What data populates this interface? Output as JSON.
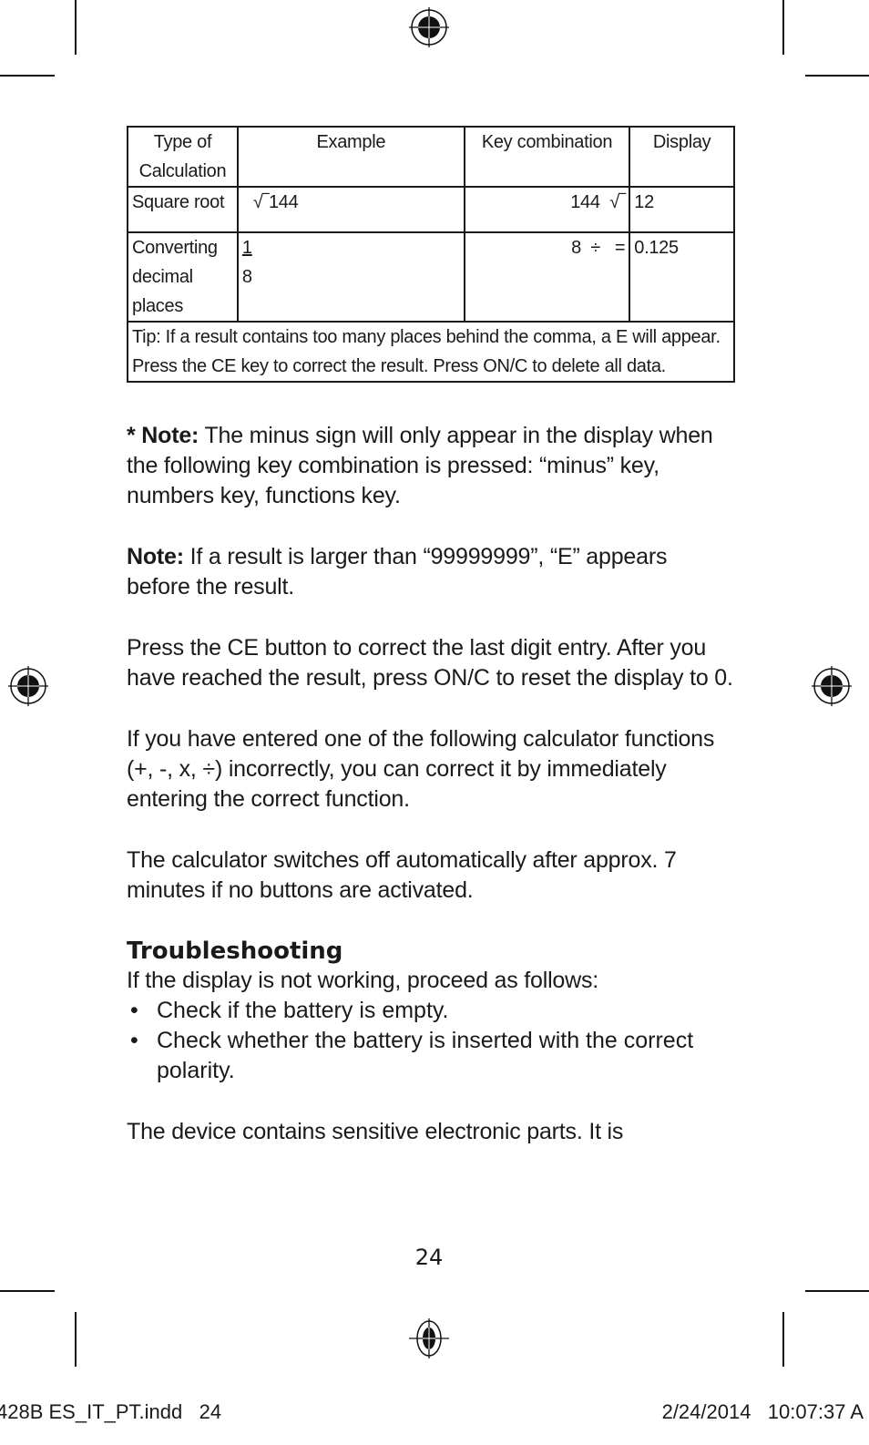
{
  "table": {
    "headers": [
      "Type of Calculation",
      "Example",
      "Key combination",
      "Display"
    ],
    "rows": [
      {
        "type": "Square root",
        "example": "√‾144",
        "keys": "144  √‾",
        "display": "12"
      },
      {
        "type": "Converting decimal places",
        "example_numerator": "1",
        "example_denominator": "8",
        "keys": "8  ÷   =",
        "display": "0.125"
      }
    ],
    "tip": "Tip: If a result contains too many places behind the comma, a E will appear. Press the CE key to correct the result. Press ON/C to delete all data."
  },
  "paragraphs": {
    "note1_label": "* Note:",
    "note1_text": " The minus sign will only appear in the display when the following key combination is pressed: “minus” key, numbers key, functions key.",
    "note2_label": "Note:",
    "note2_text": " If a result is larger than “99999999”, “E” appears before the result.",
    "ce": "Press the CE button to correct the last digit entry. After you have reached the result, press ON/C to reset the display to 0.",
    "functions": "If you have entered one of the following calculator functions (+, -, x, ÷) incorrectly, you can correct it by immediately entering the correct function.",
    "autooff": "The calculator switches off automatically after approx. 7 minutes if no buttons are activated."
  },
  "troubleshooting": {
    "heading": "Troubleshooting",
    "intro": "If the display is not working, proceed as follows:",
    "items": [
      "Check if the battery is empty.",
      "Check whether the battery is inserted with the correct polarity."
    ]
  },
  "closing": "The device contains sensitive electronic parts. It is",
  "page_number": "24",
  "slug": {
    "file": "428B ES_IT_PT.indd   24",
    "datetime": "2/24/2014   10:07:37 A"
  }
}
